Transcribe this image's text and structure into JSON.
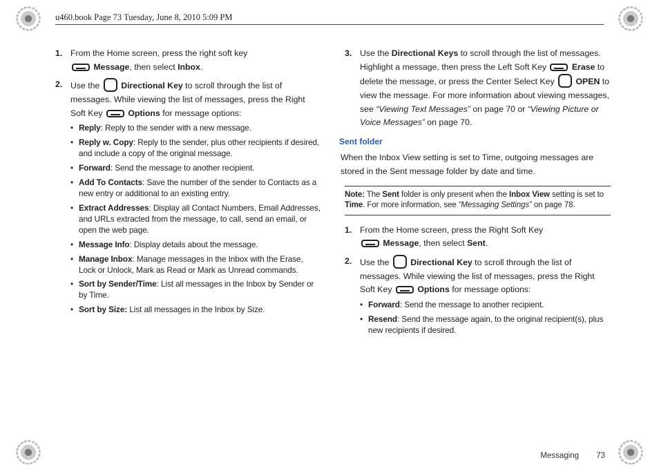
{
  "header": {
    "text": "u460.book  Page 73  Tuesday, June 8, 2010  5:09 PM"
  },
  "col1": {
    "step1_num": "1.",
    "step1_a": "From the Home screen, press the right soft key",
    "step1_b_label": "Message",
    "step1_c": ", then select ",
    "step1_d_label": "Inbox",
    "step1_e": ".",
    "step2_num": "2.",
    "step2_a": "Use the ",
    "step2_key": "Directional Key",
    "step2_b": " to scroll through the list of messages. While viewing the list of messages, press the Right Soft Key ",
    "step2_opt": "Options",
    "step2_c": " for message options:",
    "bullets": {
      "reply_t": "Reply",
      "reply_d": ": Reply to the sender with a new message.",
      "replyw_t": "Reply w. Copy",
      "replyw_d": ": Reply to the sender, plus other recipients if desired, and include a copy of the original message.",
      "fwd_t": "Forward",
      "fwd_d": ": Send the message to another recipient.",
      "add_t": "Add To Contacts",
      "add_d": ": Save the number of the sender to Contacts as a new entry or additional to an existing entry.",
      "ext_t": "Extract Addresses",
      "ext_d": ": Display all Contact Numbers, Email Addresses, and URLs extracted from the message, to call, send an email, or open the web page.",
      "info_t": "Message Info",
      "info_d": ": Display details about the message.",
      "mng_t": "Manage Inbox",
      "mng_d": ": Manage messages in the Inbox with the Erase, Lock or Unlock, Mark as Read or Mark as Unread commands.",
      "sst_t": "Sort by Sender/Time",
      "sst_d": ":  List all messages in the Inbox by Sender or by Time.",
      "ssz_t": "Sort by Size:",
      "ssz_d": " List all messages in the Inbox by Size."
    }
  },
  "col2": {
    "step3_num": "3.",
    "step3_a": "Use the ",
    "step3_dk": "Directional Keys",
    "step3_b": " to scroll through the list of messages. Highlight a message, then press the Left Soft Key ",
    "step3_erase": "Erase",
    "step3_c": "  to delete the message, or press the Center Select Key ",
    "step3_open": "OPEN",
    "step3_d": " to view the message. For more information about viewing messages, see ",
    "step3_ref1": "“Viewing Text Messages”",
    "step3_ref1p": " on page 70 or ",
    "step3_ref2": "“Viewing Picture or Voice Messages”",
    "step3_ref2p": " on page 70.",
    "sect": "Sent folder",
    "sent_intro": "When the Inbox View setting is set to Time, outgoing messages are stored in the Sent message folder by date and time.",
    "note_label": "Note:",
    "note_a": " The ",
    "note_sent": "Sent",
    "note_b": " folder is only present when the ",
    "note_iv": "Inbox View",
    "note_c": " setting is set to ",
    "note_time": "Time",
    "note_d": ". For more information, see ",
    "note_ref": "“Messaging Settings”",
    "note_e": " on page 78.",
    "s1_num": "1.",
    "s1_a": "From the Home screen, press the Right Soft Key",
    "s1_msg": "Message",
    "s1_b": ", then select ",
    "s1_sent": "Sent",
    "s1_c": ".",
    "s2_num": "2.",
    "s2_a": "Use the ",
    "s2_dk": "Directional Key",
    "s2_b": " to scroll through the list of messages. While viewing the list of messages, press the Right Soft Key ",
    "s2_opt": "Options",
    "s2_c": " for message options:",
    "bullets2": {
      "fwd_t": "Forward",
      "fwd_d": ": Send the message to another recipient.",
      "rs_t": "Resend",
      "rs_d": ": Send the message again, to the original recipient(s), plus new recipients if desired."
    }
  },
  "footer": {
    "section": "Messaging",
    "page": "73"
  }
}
